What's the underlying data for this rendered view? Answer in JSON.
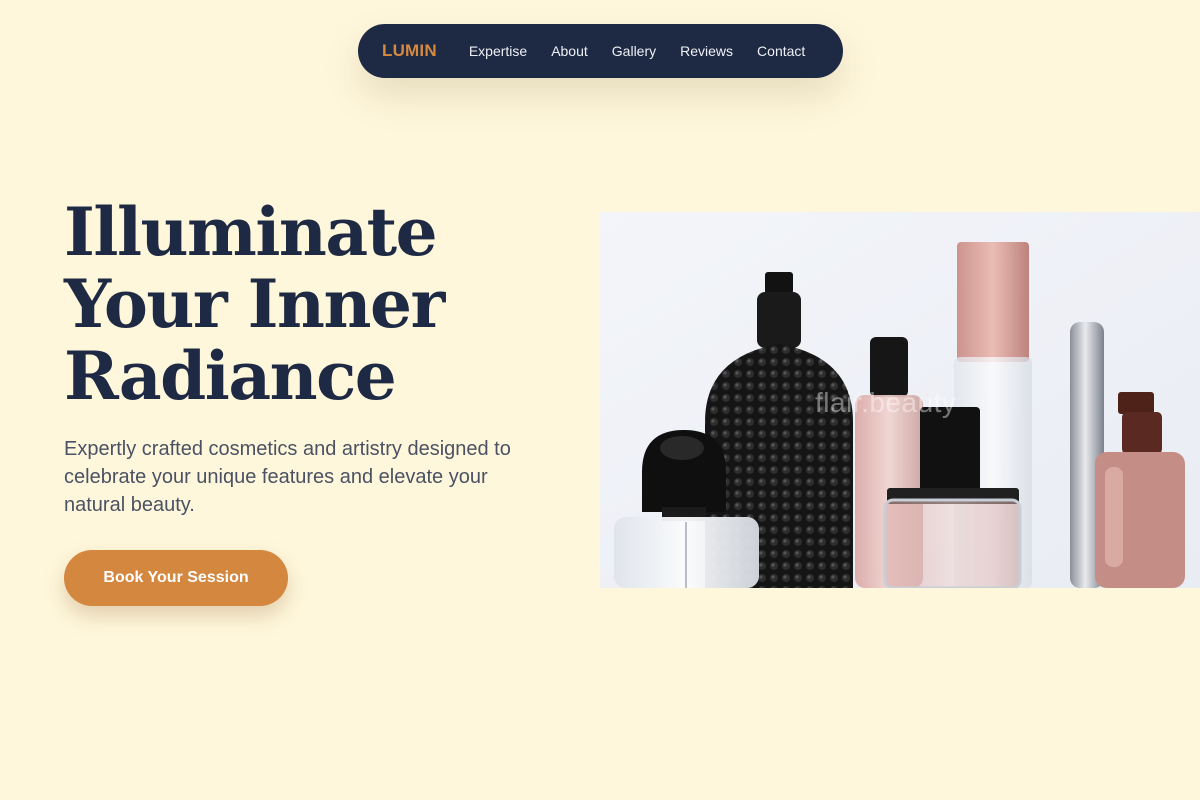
{
  "nav": {
    "brand": "LUMIN",
    "links": [
      "Expertise",
      "About",
      "Gallery",
      "Reviews",
      "Contact"
    ]
  },
  "hero": {
    "title_lines": [
      "Illuminate",
      "Your Inner",
      "Radiance"
    ],
    "subtitle": "Expertly crafted cosmetics and artistry designed to celebrate your unique features and elevate your natural beauty.",
    "cta_label": "Book Your Session",
    "image_watermark": "flair.beauty"
  },
  "colors": {
    "background": "#fff7dc",
    "navbar": "#1e2a44",
    "accent": "#d4873f",
    "heading": "#1e2a44",
    "body_text": "#4a5263"
  }
}
